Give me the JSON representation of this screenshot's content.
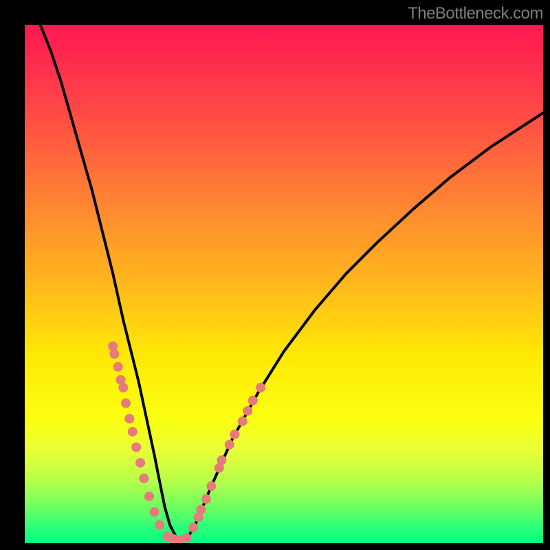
{
  "watermark": "TheBottleneck.com",
  "chart_data": {
    "type": "line",
    "title": "",
    "xlabel": "",
    "ylabel": "",
    "xlim": [
      0,
      100
    ],
    "ylim": [
      0,
      100
    ],
    "series": [
      {
        "name": "bottleneck-curve",
        "x": [
          3,
          5,
          7,
          9,
          11,
          13,
          15,
          17,
          19,
          20.5,
          22,
          23.5,
          25,
          26,
          27,
          28,
          29.3,
          30.5,
          31.5,
          33,
          36,
          40,
          45,
          50,
          56,
          62,
          68,
          75,
          82,
          90,
          100
        ],
        "y": [
          100,
          95,
          89,
          82,
          75,
          68,
          60,
          52,
          43,
          37,
          31,
          24,
          17,
          12,
          7,
          3.5,
          1,
          0.5,
          1.2,
          3.8,
          11,
          20,
          29,
          37,
          45,
          52,
          58,
          64.5,
          70.5,
          76.5,
          83
        ]
      }
    ],
    "dot_clusters": [
      {
        "name": "left-branch-dots",
        "points": [
          {
            "x": 17.0,
            "y": 38.0
          },
          {
            "x": 17.3,
            "y": 36.5
          },
          {
            "x": 18.0,
            "y": 34.0
          },
          {
            "x": 18.5,
            "y": 31.5
          },
          {
            "x": 19.0,
            "y": 30.0
          },
          {
            "x": 19.5,
            "y": 27.0
          },
          {
            "x": 20.2,
            "y": 24.0
          },
          {
            "x": 20.8,
            "y": 21.5
          },
          {
            "x": 21.5,
            "y": 18.5
          },
          {
            "x": 22.3,
            "y": 15.5
          },
          {
            "x": 23.0,
            "y": 12.5
          },
          {
            "x": 24.0,
            "y": 9.0
          },
          {
            "x": 25.0,
            "y": 6.0
          },
          {
            "x": 26.0,
            "y": 3.5
          }
        ]
      },
      {
        "name": "right-branch-dots",
        "points": [
          {
            "x": 32.5,
            "y": 3.0
          },
          {
            "x": 33.5,
            "y": 5.0
          },
          {
            "x": 34.0,
            "y": 6.5
          },
          {
            "x": 35.0,
            "y": 8.5
          },
          {
            "x": 36.0,
            "y": 11.0
          },
          {
            "x": 37.5,
            "y": 14.5
          },
          {
            "x": 38.0,
            "y": 16.0
          },
          {
            "x": 39.5,
            "y": 19.0
          },
          {
            "x": 40.5,
            "y": 21.0
          },
          {
            "x": 42.0,
            "y": 23.5
          },
          {
            "x": 43.0,
            "y": 25.5
          },
          {
            "x": 44.0,
            "y": 27.5
          },
          {
            "x": 45.5,
            "y": 30.0
          }
        ]
      },
      {
        "name": "bottom-trough-dots",
        "points": [
          {
            "x": 27.5,
            "y": 1.3
          },
          {
            "x": 28.7,
            "y": 0.8
          },
          {
            "x": 30.0,
            "y": 0.6
          },
          {
            "x": 31.2,
            "y": 1.0
          }
        ]
      }
    ],
    "colors": {
      "curve": "#000000",
      "dots": "#e77a7a",
      "gradient_top": "#ff1850",
      "gradient_bottom": "#00ff82"
    }
  }
}
